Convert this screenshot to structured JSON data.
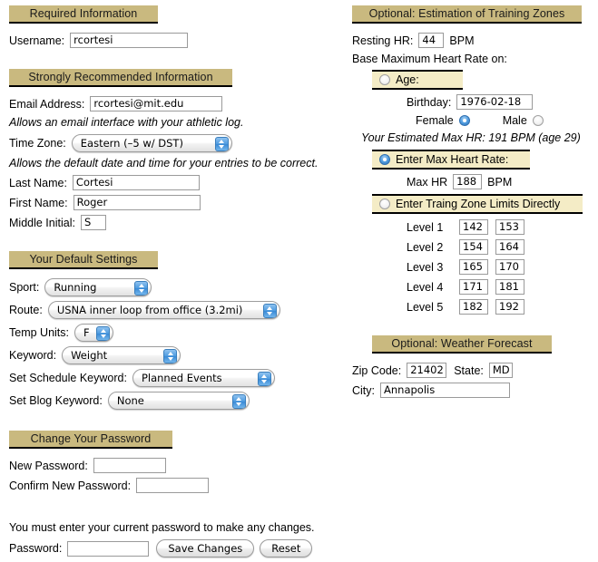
{
  "left": {
    "required": {
      "header": "Required Information",
      "username_label": "Username:",
      "username_value": "rcortesi"
    },
    "recommended": {
      "header": "Strongly Recommended Information",
      "email_label": "Email Address:",
      "email_value": "rcortesi@mit.edu",
      "email_note": "Allows an email interface with your athletic log.",
      "timezone_label": "Time Zone:",
      "timezone_value": "Eastern (–5 w/ DST)",
      "timezone_note": "Allows the default date and time for your entries to be correct.",
      "lastname_label": "Last Name:",
      "lastname_value": "Cortesi",
      "firstname_label": "First Name:",
      "firstname_value": "Roger",
      "middle_label": "Middle Initial:",
      "middle_value": "S"
    },
    "defaults": {
      "header": "Your Default Settings",
      "sport_label": "Sport:",
      "sport_value": "Running",
      "route_label": "Route:",
      "route_value": "USNA inner loop from office (3.2mi)",
      "temp_label": "Temp Units:",
      "temp_value": "F",
      "keyword_label": "Keyword:",
      "keyword_value": "Weight",
      "schedule_label": "Set Schedule Keyword:",
      "schedule_value": "Planned Events",
      "blog_label": "Set Blog Keyword:",
      "blog_value": "None"
    },
    "password": {
      "header": "Change Your Password",
      "new_label": "New Password:",
      "new_value": "",
      "confirm_label": "Confirm New Password:",
      "confirm_value": "",
      "warning": "You must enter your current password to make any changes.",
      "current_label": "Password:",
      "current_value": "",
      "save_label": "Save Changes",
      "reset_label": "Reset"
    }
  },
  "right": {
    "zones": {
      "header": "Optional: Estimation of Training Zones",
      "resting_label": "Resting HR:",
      "resting_value": "44",
      "resting_unit": "BPM",
      "base_on_label": "Base Maximum Heart Rate on:",
      "age_option": {
        "label": "Age:",
        "selected": false,
        "birthday_label": "Birthday:",
        "birthday_value": "1976-02-18",
        "female_label": "Female",
        "female_selected": true,
        "male_label": "Male",
        "male_selected": false,
        "estimate_note": "Your Estimated Max HR: 191 BPM (age 29)"
      },
      "maxhr_option": {
        "label": "Enter Max Heart Rate:",
        "selected": true,
        "maxhr_label": "Max HR",
        "maxhr_value": "188",
        "maxhr_unit": "BPM"
      },
      "direct_option": {
        "label": "Enter Traing Zone Limits Directly",
        "selected": false,
        "levels": [
          {
            "label": "Level 1",
            "low": "142",
            "high": "153"
          },
          {
            "label": "Level 2",
            "low": "154",
            "high": "164"
          },
          {
            "label": "Level 3",
            "low": "165",
            "high": "170"
          },
          {
            "label": "Level 4",
            "low": "171",
            "high": "181"
          },
          {
            "label": "Level 5",
            "low": "182",
            "high": "192"
          }
        ]
      }
    },
    "weather": {
      "header": "Optional: Weather Forecast",
      "zip_label": "Zip Code:",
      "zip_value": "21402",
      "state_label": "State:",
      "state_value": "MD",
      "city_label": "City:",
      "city_value": "Annapolis"
    }
  },
  "colors": {
    "section_header_bg": "#c9b97f",
    "radio_bar_bg": "#f4ecc6",
    "accent_blue": "#4f9ce0",
    "page_bg": "#ffffff"
  }
}
